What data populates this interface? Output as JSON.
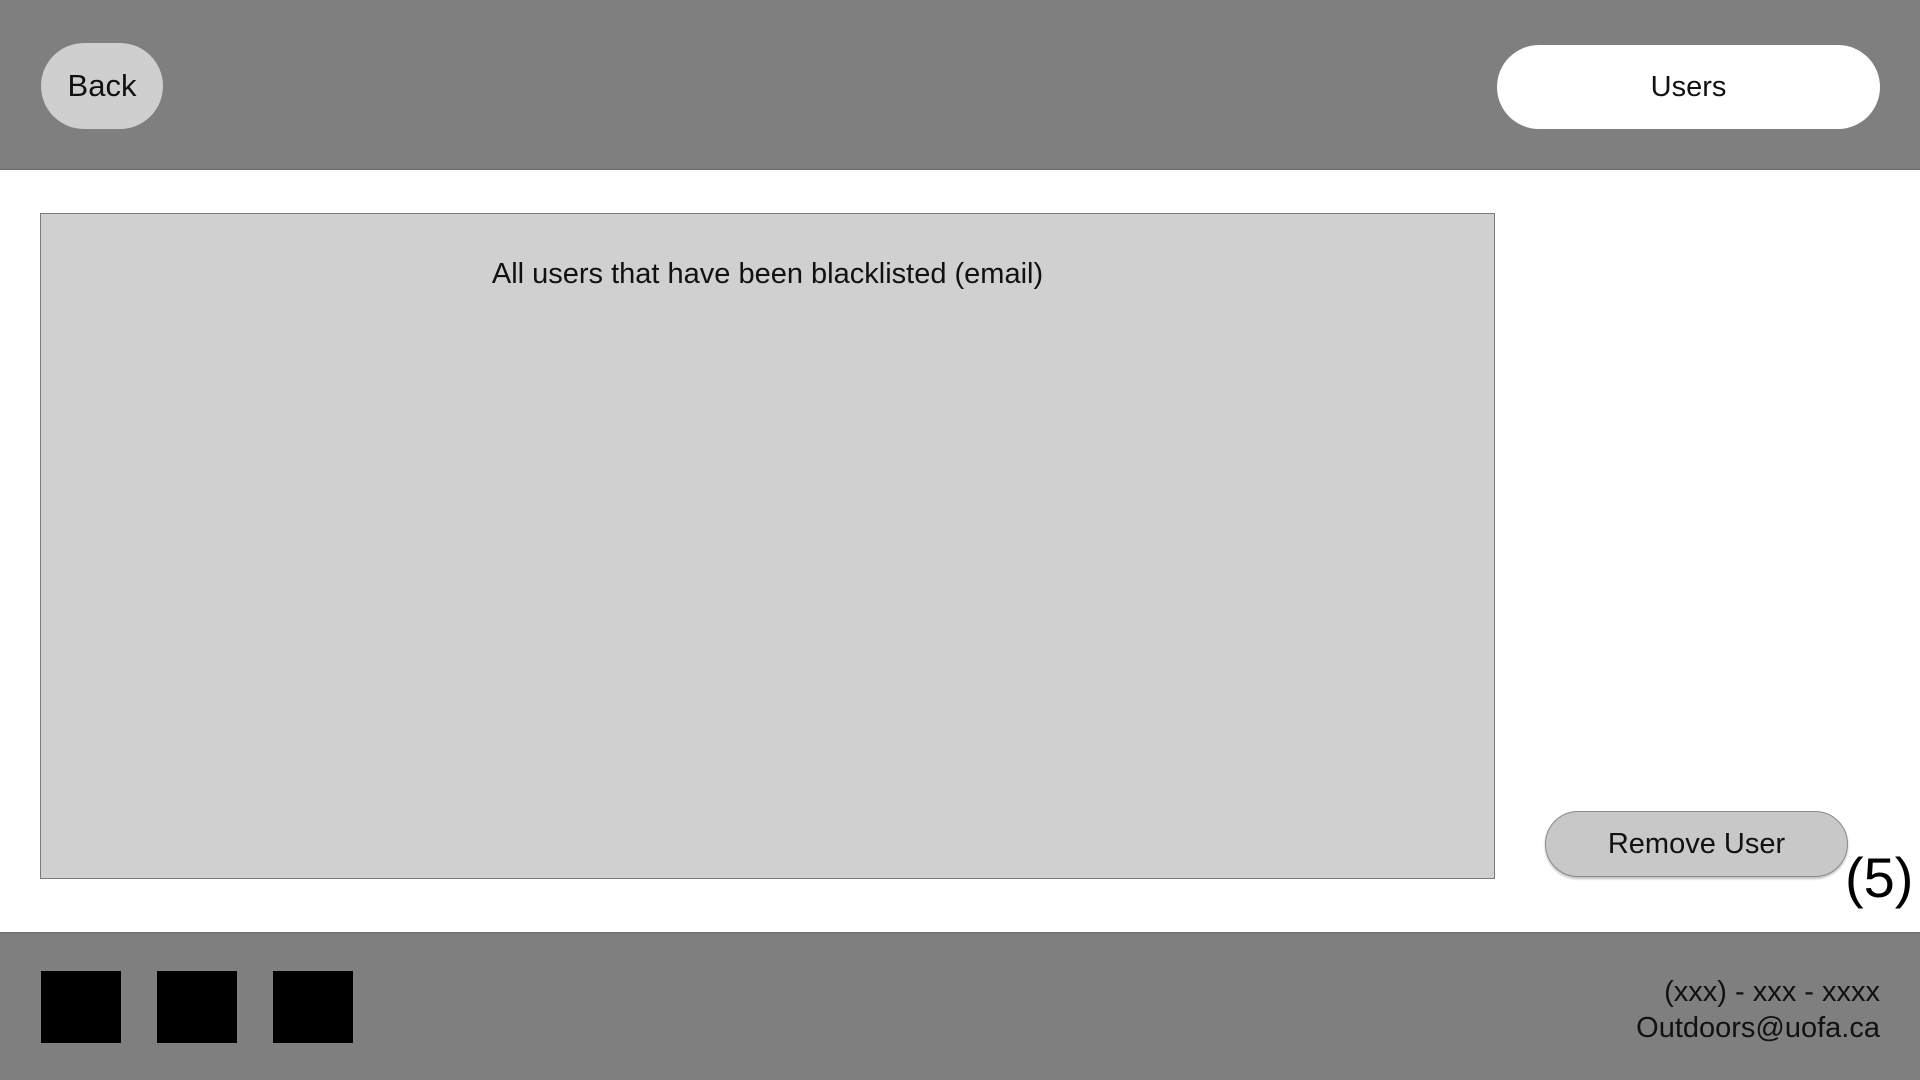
{
  "header": {
    "back_label": "Back",
    "users_label": "Users"
  },
  "main": {
    "list_heading": "All users that have been blacklisted (email)",
    "blacklisted_users": [],
    "remove_user_label": "Remove User",
    "step_label": "(5)"
  },
  "footer": {
    "social_icons": [
      "social-icon-1",
      "social-icon-2",
      "social-icon-3"
    ],
    "phone": "(xxx) - xxx - xxxx",
    "email": "Outdoors@uofa.ca"
  },
  "colors": {
    "header_footer_bg": "#7f7f7f",
    "panel_bg": "#d0d0d0",
    "button_bg": "#cfcfcf"
  }
}
